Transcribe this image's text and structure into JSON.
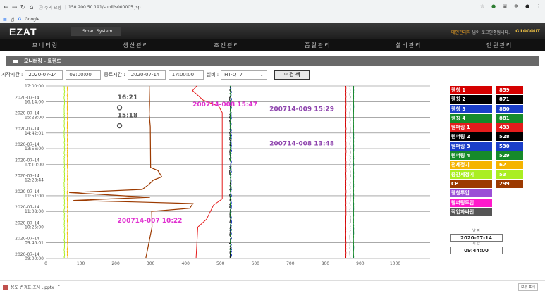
{
  "browser": {
    "security_label": "주의 요함",
    "url": "150.200.50.191/sunil/s000005.jsp",
    "bookmark_google": "Google",
    "bookmark_apps": "앱"
  },
  "header": {
    "logo": "EZAT",
    "subbrand": "Smart System",
    "welcome_name": "메인관리자",
    "welcome_text": " 님이 로그인중입니다.",
    "logout": "LOGOUT"
  },
  "nav": {
    "items": [
      "모니터링",
      "생산관리",
      "조건관리",
      "품질관리",
      "설비관리",
      "인원관리"
    ]
  },
  "page_title": "모니터링 - 트렌드",
  "filter": {
    "start_label": "시작시간 :",
    "start_date": "2020-07-14",
    "start_time": "09:00:00",
    "end_label": "종료시간 :",
    "end_date": "2020-07-14",
    "end_time": "17:00:00",
    "equip_label": "설비 :",
    "equip_value": "HT-QT7",
    "search_label": "검 색"
  },
  "chart_data": {
    "type": "line",
    "x_ticks": [
      0,
      100,
      200,
      300,
      400,
      500,
      600,
      700,
      800,
      900,
      1000
    ],
    "xlim": [
      0,
      1100
    ],
    "y_labels": [
      {
        "date": "",
        "time": "17:00:00"
      },
      {
        "date": "2020-07-14",
        "time": "16:14:00"
      },
      {
        "date": "2020-07-14",
        "time": "15:28:00"
      },
      {
        "date": "2020-07-14",
        "time": "14:42:01"
      },
      {
        "date": "2020-07-14",
        "time": "13:56:00"
      },
      {
        "date": "2020-07-14",
        "time": "13:10:00"
      },
      {
        "date": "2020-07-14",
        "time": "12:28:44"
      },
      {
        "date": "2020-07-14",
        "time": "11:51:00"
      },
      {
        "date": "2020-07-14",
        "time": "11:08:00"
      },
      {
        "date": "2020-07-14",
        "time": "10:25:00"
      },
      {
        "date": "2020-07-14",
        "time": "09:46:01"
      },
      {
        "date": "2020-07-14",
        "time": "09:00:00"
      }
    ],
    "annotations": [
      {
        "text": "200714-008 15:47",
        "x": 420,
        "row": 1.3,
        "color": "#e030d0"
      },
      {
        "text": "200714-009 15:29",
        "x": 640,
        "row": 1.6,
        "color": "#8e44ad"
      },
      {
        "text": "200714-008 13:48",
        "x": 640,
        "row": 3.8,
        "color": "#8e44ad"
      },
      {
        "text": "200714-007 10:22",
        "x": 205,
        "row": 8.7,
        "color": "#e030d0"
      },
      {
        "text": "16:21",
        "x": 205,
        "row": 0.85,
        "color": "#555555"
      },
      {
        "text": "15:18",
        "x": 205,
        "row": 2.0,
        "color": "#555555"
      }
    ],
    "series": [
      {
        "name": "퀜칭 1",
        "value": 859,
        "color": "#d50000"
      },
      {
        "name": "퀜칭 2",
        "value": 871,
        "color": "#000000"
      },
      {
        "name": "퀜칭 3",
        "value": 880,
        "color": "#1a3ec8"
      },
      {
        "name": "퀜칭 4",
        "value": 881,
        "color": "#168a2a"
      },
      {
        "name": "템퍼링 1",
        "value": 433,
        "color": "#e51c1c"
      },
      {
        "name": "템퍼링 2",
        "value": 528,
        "color": "#000000"
      },
      {
        "name": "템퍼링 3",
        "value": 530,
        "color": "#1a3ec8"
      },
      {
        "name": "템퍼링 4",
        "value": 529,
        "color": "#168a2a"
      },
      {
        "name": "전세정기",
        "value": 62,
        "color": "#f5b400"
      },
      {
        "name": "중간세정기",
        "value": 53,
        "color": "#aaee22"
      },
      {
        "name": "CP",
        "value": 299,
        "color": "#9c3a00"
      }
    ],
    "extra_legend": [
      {
        "name": "퀜칭투입",
        "color": "#9b4fd6"
      },
      {
        "name": "템퍼링투입",
        "color": "#ff1acb"
      },
      {
        "name": "작업자싸인",
        "color": "#555555"
      }
    ]
  },
  "datetime": {
    "date_caption": "날 짜",
    "date": "2020-07-14",
    "time_caption": "시 간",
    "time": "09:44:00"
  },
  "downloads": {
    "file": "용도 변경표 조사 ..pptx",
    "show_all": "모두 표시"
  }
}
